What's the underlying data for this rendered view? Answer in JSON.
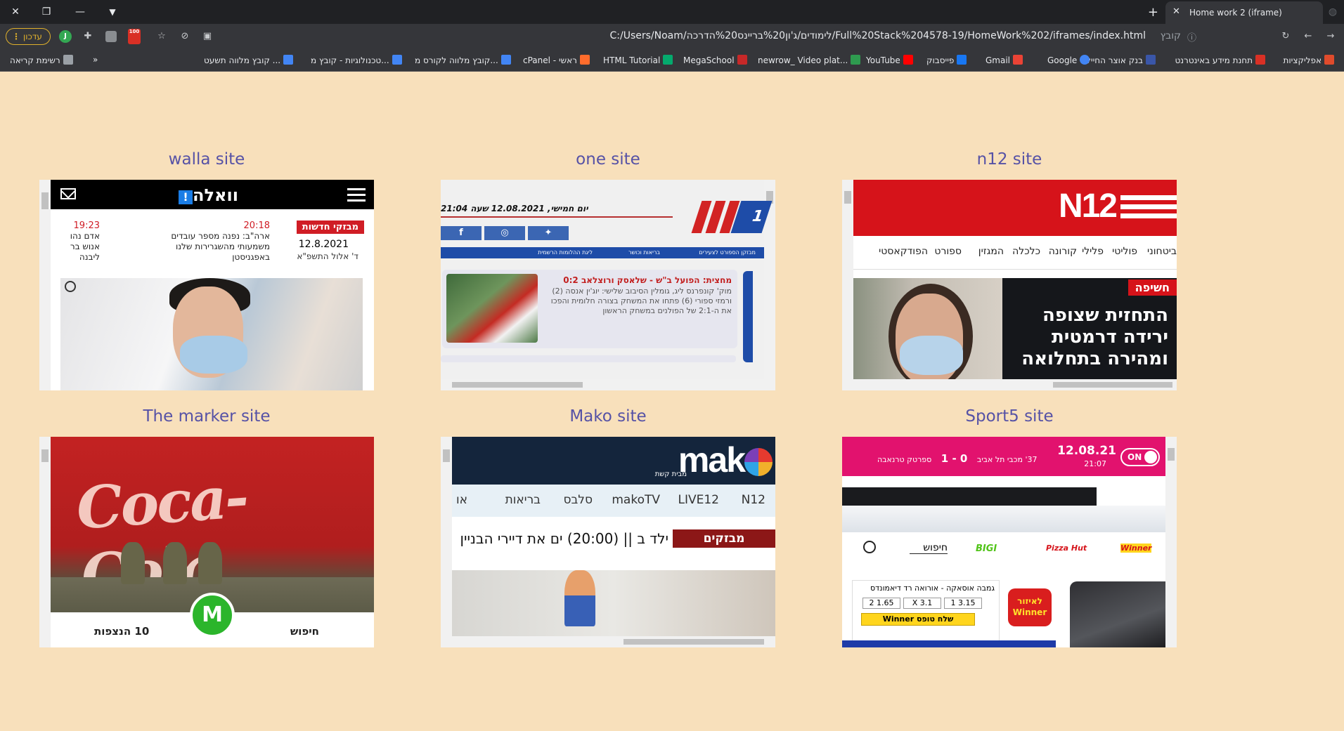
{
  "browser": {
    "tab_title": "Home work 2 (iframe)",
    "url": "C:/Users/Noam/לימודים/ג'ון%20בריינס%20הדרכה/Full%20Stack%204578-19/HomeWork%202/iframes/index.html",
    "scheme_label": "קובץ",
    "profile_label": "עדכון",
    "profile_letter": "J",
    "ext_badge": "100",
    "bookmarks": [
      {
        "label": "אפליקציות",
        "color": "#e04b2c"
      },
      {
        "label": "תחנת מידע באינטרנט",
        "color": "#d93025"
      },
      {
        "label": "בנק אוצר החייל",
        "color": "#3a56a8"
      },
      {
        "label": "Google",
        "color": "#4285f4"
      },
      {
        "label": "Gmail",
        "color": "#ea4335"
      },
      {
        "label": "פייסבוק",
        "color": "#1877f2"
      },
      {
        "label": "YouTube",
        "color": "#ff0000"
      },
      {
        "label": "newrow_ Video plat...",
        "color": "#2e9b4f"
      },
      {
        "label": "MegaSchool",
        "color": "#c62828"
      },
      {
        "label": "HTML Tutorial",
        "color": "#04aa6d"
      },
      {
        "label": "cPanel - ראשי",
        "color": "#ff6c2c"
      },
      {
        "label": "קובץ מלווה לקורס מ...",
        "color": "#4285f4"
      },
      {
        "label": "טכנולוגיות - קובץ מ...",
        "color": "#4285f4"
      },
      {
        "label": "קובץ מלווה תשעט ...",
        "color": "#4285f4"
      },
      {
        "label": "רשימת קריאה",
        "color": "#9aa0a6"
      }
    ]
  },
  "sites": {
    "walla": {
      "title": "walla site",
      "logo": "וואלה",
      "badge": "מבזקי חדשות",
      "date": "12.8.2021",
      "hebdate": "ד' אלול התשפ\"א",
      "item1_time": "20:18",
      "item1_text": "ארה\"ב: נפנה מספר עובדים משמעותי מהשגרירות שלנו באפגניסטן",
      "item2_time": "19:23",
      "item2_text": "אדם נהו אנוש בר ליבנה"
    },
    "one": {
      "title": "one site",
      "date": "יום חמישי, 12.08.2021 שעה 21:04",
      "logo": "1",
      "nav": [
        "מבזקן הספורט לצעירים",
        "בריאות וכושר",
        "ליגת ההלומות הרשמית"
      ],
      "card_title": "מחצית: הפועל ב\"ש - שלאסק ורוצלאב 0:2",
      "card_text": "מוק' קונפרנס ליג, גומלין הסיבוב שלישי: יוג'ין אנסה (2) ורמזי ספורי (6) פתחו את המשחק בצורה חלומית והפכו את ה-2:1 של הפולנים במשחק הראשון"
    },
    "n12": {
      "title": "n12 site",
      "logo": "N12",
      "nav": [
        "ביטחוני",
        "פוליטי",
        "פלילי",
        "קורונה",
        "כלכלה",
        "המגזין",
        "ספורט",
        "הפודקאסטי"
      ],
      "badge": "חשיפה",
      "headline": "התחזית שצופה ירידה דרמטית ומהירה בתחלואה"
    },
    "marker": {
      "title": "The marker site",
      "coke": "Coca-Cola",
      "circle": "M",
      "left_label": "10 הנצפות",
      "right_label": "חיפוש"
    },
    "mako": {
      "title": "Mako site",
      "logo": "mak",
      "sub": "מבית קשת",
      "nav": [
        "N12",
        "LIVE12",
        "makoTV",
        "סלבס",
        "בריאות",
        "או"
      ],
      "badge": "מבזקים",
      "ticker": "ילד ב || (20:00) ים את דיירי הבניין"
    },
    "sport5": {
      "title": "Sport5 site",
      "date": "12.08.21",
      "time": "21:07",
      "on": "ON",
      "minute": "37'",
      "team1": "מכבי תל אביב",
      "score": "0 - 1",
      "team2": "ספרטק טרנאבה",
      "search": "חיפוש",
      "sponsors": [
        "Winner",
        "Pizza Hut",
        "BIGI"
      ],
      "card_title": "גמבה אוסאקה - אורואה רד דיאמונדס",
      "odds": [
        "1  3.15",
        "X  3.1",
        "2  1.65"
      ],
      "send": "שלח טופס Winner",
      "winner_logo": "לאיזור Winner"
    }
  }
}
